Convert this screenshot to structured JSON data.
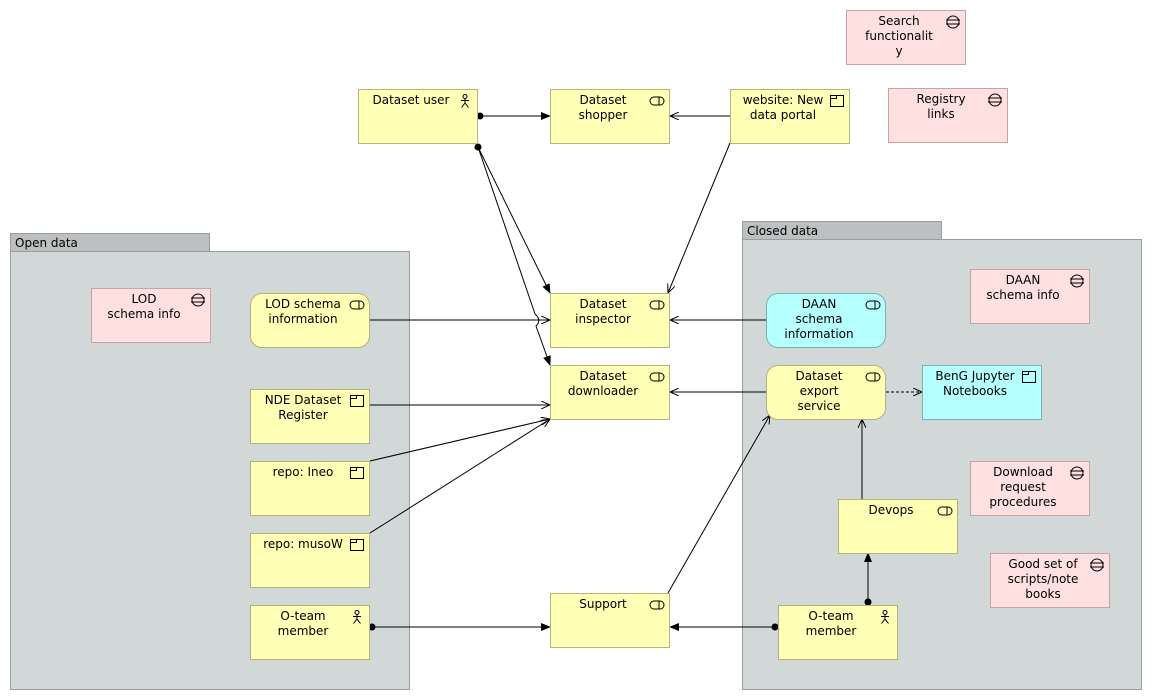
{
  "groups": {
    "open": {
      "label": "Open data"
    },
    "closed": {
      "label": "Closed data"
    }
  },
  "nodes": {
    "search": {
      "label": "Search\nfunctionalit\ny",
      "type": "principle",
      "icon": "principle-icon"
    },
    "registry": {
      "label": "Registry\nlinks",
      "type": "principle",
      "icon": "principle-icon"
    },
    "dataset_user": {
      "label": "Dataset user",
      "type": "business-actor",
      "icon": "actor-icon"
    },
    "shopper": {
      "label": "Dataset\nshopper",
      "type": "service",
      "icon": "service-icon"
    },
    "website": {
      "label": "website: New\ndata portal",
      "type": "application-component",
      "icon": "component-icon"
    },
    "lod_info": {
      "label": "LOD\nschema info",
      "type": "principle",
      "icon": "principle-icon"
    },
    "lod_schema": {
      "label": "LOD schema\ninformation",
      "type": "service",
      "icon": "service-icon"
    },
    "nde": {
      "label": "NDE Dataset\nRegister",
      "type": "application-component",
      "icon": "component-icon"
    },
    "ineo": {
      "label": "repo: Ineo",
      "type": "application-component",
      "icon": "component-icon"
    },
    "musow": {
      "label": "repo: musoW",
      "type": "application-component",
      "icon": "component-icon"
    },
    "oteam_left": {
      "label": "O-team\nmember",
      "type": "business-actor",
      "icon": "actor-icon"
    },
    "inspector": {
      "label": "Dataset\ninspector",
      "type": "service",
      "icon": "service-icon"
    },
    "downloader": {
      "label": "Dataset\ndownloader",
      "type": "service",
      "icon": "service-icon"
    },
    "support": {
      "label": "Support",
      "type": "service",
      "icon": "service-icon"
    },
    "daan_schema": {
      "label": "DAAN\nschema\ninformation",
      "type": "service",
      "icon": "service-icon"
    },
    "daan_info": {
      "label": "DAAN\nschema info",
      "type": "principle",
      "icon": "principle-icon"
    },
    "export": {
      "label": "Dataset\nexport\nservice",
      "type": "service",
      "icon": "service-icon"
    },
    "beng": {
      "label": "BenG Jupyter\nNotebooks",
      "type": "application-component",
      "icon": "component-icon"
    },
    "download_req": {
      "label": "Download\nrequest\nprocedures",
      "type": "principle",
      "icon": "principle-icon"
    },
    "devops": {
      "label": "Devops",
      "type": "service",
      "icon": "service-icon"
    },
    "good_set": {
      "label": "Good set of\nscripts/note\nbooks",
      "type": "principle",
      "icon": "principle-icon"
    },
    "oteam_right": {
      "label": "O-team\nmember",
      "type": "business-actor",
      "icon": "actor-icon"
    }
  },
  "relationships": [
    {
      "from": "dataset_user",
      "to": "shopper",
      "type": "assignment"
    },
    {
      "from": "website",
      "to": "shopper",
      "type": "serving"
    },
    {
      "from": "dataset_user",
      "to": "inspector",
      "type": "assignment"
    },
    {
      "from": "dataset_user",
      "to": "downloader",
      "type": "assignment"
    },
    {
      "from": "website",
      "to": "inspector",
      "type": "serving"
    },
    {
      "from": "lod_schema",
      "to": "inspector",
      "type": "serving"
    },
    {
      "from": "daan_schema",
      "to": "inspector",
      "type": "serving"
    },
    {
      "from": "nde",
      "to": "downloader",
      "type": "serving"
    },
    {
      "from": "ineo",
      "to": "downloader",
      "type": "serving"
    },
    {
      "from": "musow",
      "to": "downloader",
      "type": "serving"
    },
    {
      "from": "export",
      "to": "downloader",
      "type": "serving"
    },
    {
      "from": "export",
      "to": "beng",
      "type": "flow"
    },
    {
      "from": "devops",
      "to": "export",
      "type": "serving"
    },
    {
      "from": "oteam_right",
      "to": "devops",
      "type": "assignment"
    },
    {
      "from": "oteam_right",
      "to": "support",
      "type": "assignment"
    },
    {
      "from": "oteam_left",
      "to": "support",
      "type": "assignment"
    },
    {
      "from": "support",
      "to": "export",
      "type": "serving"
    }
  ],
  "colors": {
    "business": "#ffffb5",
    "principle": "#ffe0e0",
    "application": "#b5ffff",
    "group": "#d2d7d7"
  }
}
